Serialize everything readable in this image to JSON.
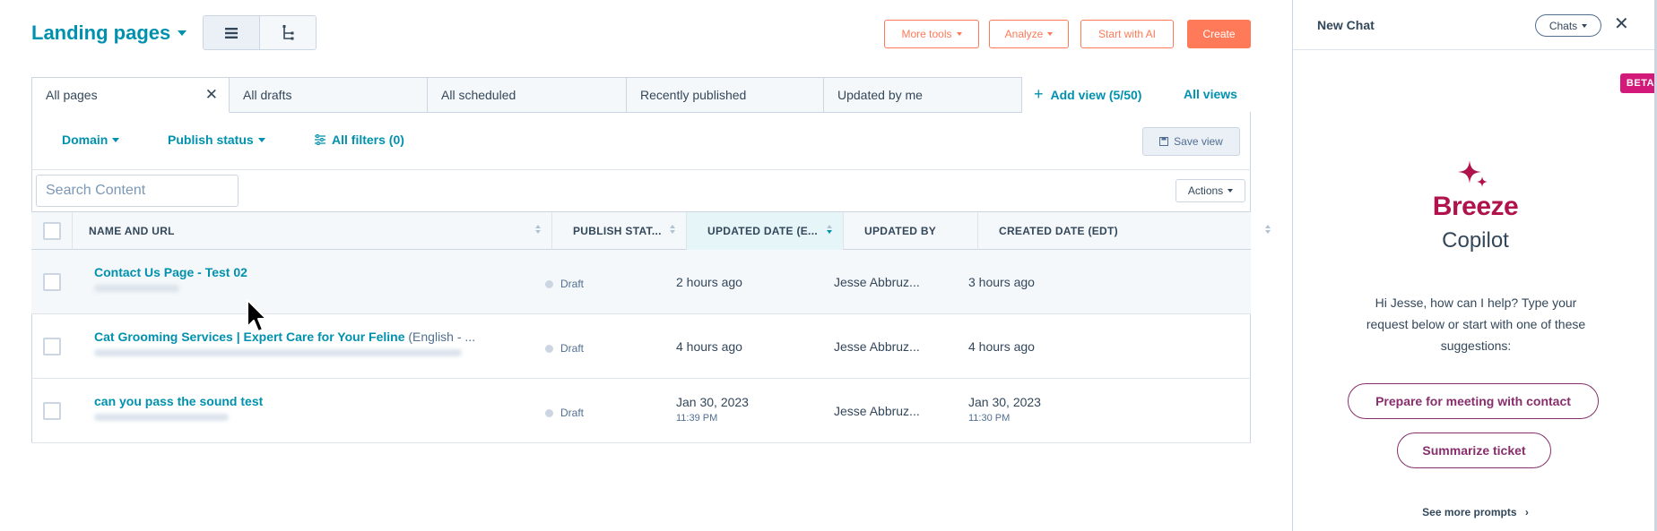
{
  "header": {
    "title": "Landing pages",
    "more_tools": "More tools",
    "analyze": "Analyze",
    "start_ai": "Start with AI",
    "create": "Create"
  },
  "tabs": [
    {
      "label": "All pages"
    },
    {
      "label": "All drafts"
    },
    {
      "label": "All scheduled"
    },
    {
      "label": "Recently published"
    },
    {
      "label": "Updated by me"
    }
  ],
  "add_view": "Add view (5/50)",
  "all_views": "All views",
  "filters": {
    "domain": "Domain",
    "publish_status": "Publish status",
    "all_filters": "All filters (0)",
    "save_view": "Save view"
  },
  "search": {
    "placeholder": "Search Content"
  },
  "actions": "Actions",
  "columns": {
    "name": "NAME AND URL",
    "status": "PUBLISH STAT...",
    "updated": "UPDATED DATE (E...",
    "updated_by": "UPDATED BY",
    "created": "CREATED DATE (EDT)"
  },
  "rows": [
    {
      "name": "Contact Us Page - Test 02",
      "lang": "",
      "status": "Draft",
      "updated": "2 hours ago",
      "updated_sub": "",
      "updated_by": "Jesse Abbruz...",
      "created": "3 hours ago",
      "created_sub": ""
    },
    {
      "name": "Cat Grooming Services | Expert Care for Your Feline",
      "lang": "(English - ...",
      "status": "Draft",
      "updated": "4 hours ago",
      "updated_sub": "",
      "updated_by": "Jesse Abbruz...",
      "created": "4 hours ago",
      "created_sub": ""
    },
    {
      "name": "can you pass the sound test",
      "lang": "",
      "status": "Draft",
      "updated": "Jan 30, 2023",
      "updated_sub": "11:39 PM",
      "updated_by": "Jesse Abbruz...",
      "created": "Jan 30, 2023",
      "created_sub": "11:30 PM"
    }
  ],
  "copilot": {
    "title": "New Chat",
    "chats": "Chats",
    "beta": "BETA",
    "brand": "Breeze",
    "product": "Copilot",
    "greeting": "Hi Jesse, how can I help? Type your request below or start with one of these suggestions:",
    "prompt1": "Prepare for meeting with contact",
    "prompt2": "Summarize ticket",
    "more": "See more prompts"
  },
  "colors": {
    "accent": "#0091ae",
    "orange": "#ff7a59",
    "breeze": "#b0134c",
    "prompt": "#872f6c"
  }
}
